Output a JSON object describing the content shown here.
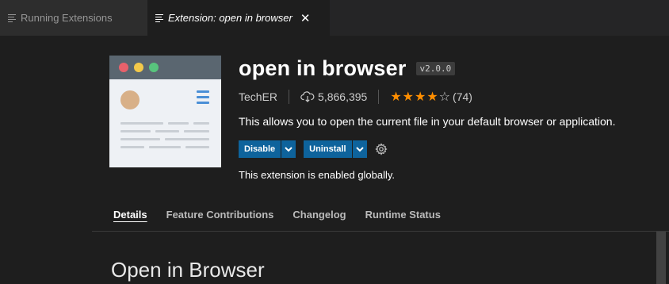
{
  "tabs": [
    {
      "label": "Running Extensions",
      "active": false
    },
    {
      "label": "Extension: open in browser",
      "active": true
    }
  ],
  "tab_close": "✕",
  "extension": {
    "name": "open in browser",
    "version": "v2.0.0",
    "publisher": "TechER",
    "installs": "5,866,395",
    "stars": "★★★★",
    "half_star": "☆",
    "rating": 3.5,
    "rating_count": "(74)",
    "description": "This allows you to open the current file in your default browser or application.",
    "status_note": "This extension is enabled globally."
  },
  "buttons": {
    "disable": "Disable",
    "uninstall": "Uninstall",
    "dropdown_glyph": "▼"
  },
  "nav": [
    "Details",
    "Feature Contributions",
    "Changelog",
    "Runtime Status"
  ],
  "readme_title": "Open in Browser",
  "colors": {
    "accent_button": "#0e639c",
    "star": "#ff8e00",
    "background": "#1e1e1e"
  },
  "icons": [
    "list-icon",
    "close-icon",
    "cloud-download-icon",
    "gear-icon",
    "chevron-down-icon"
  ]
}
